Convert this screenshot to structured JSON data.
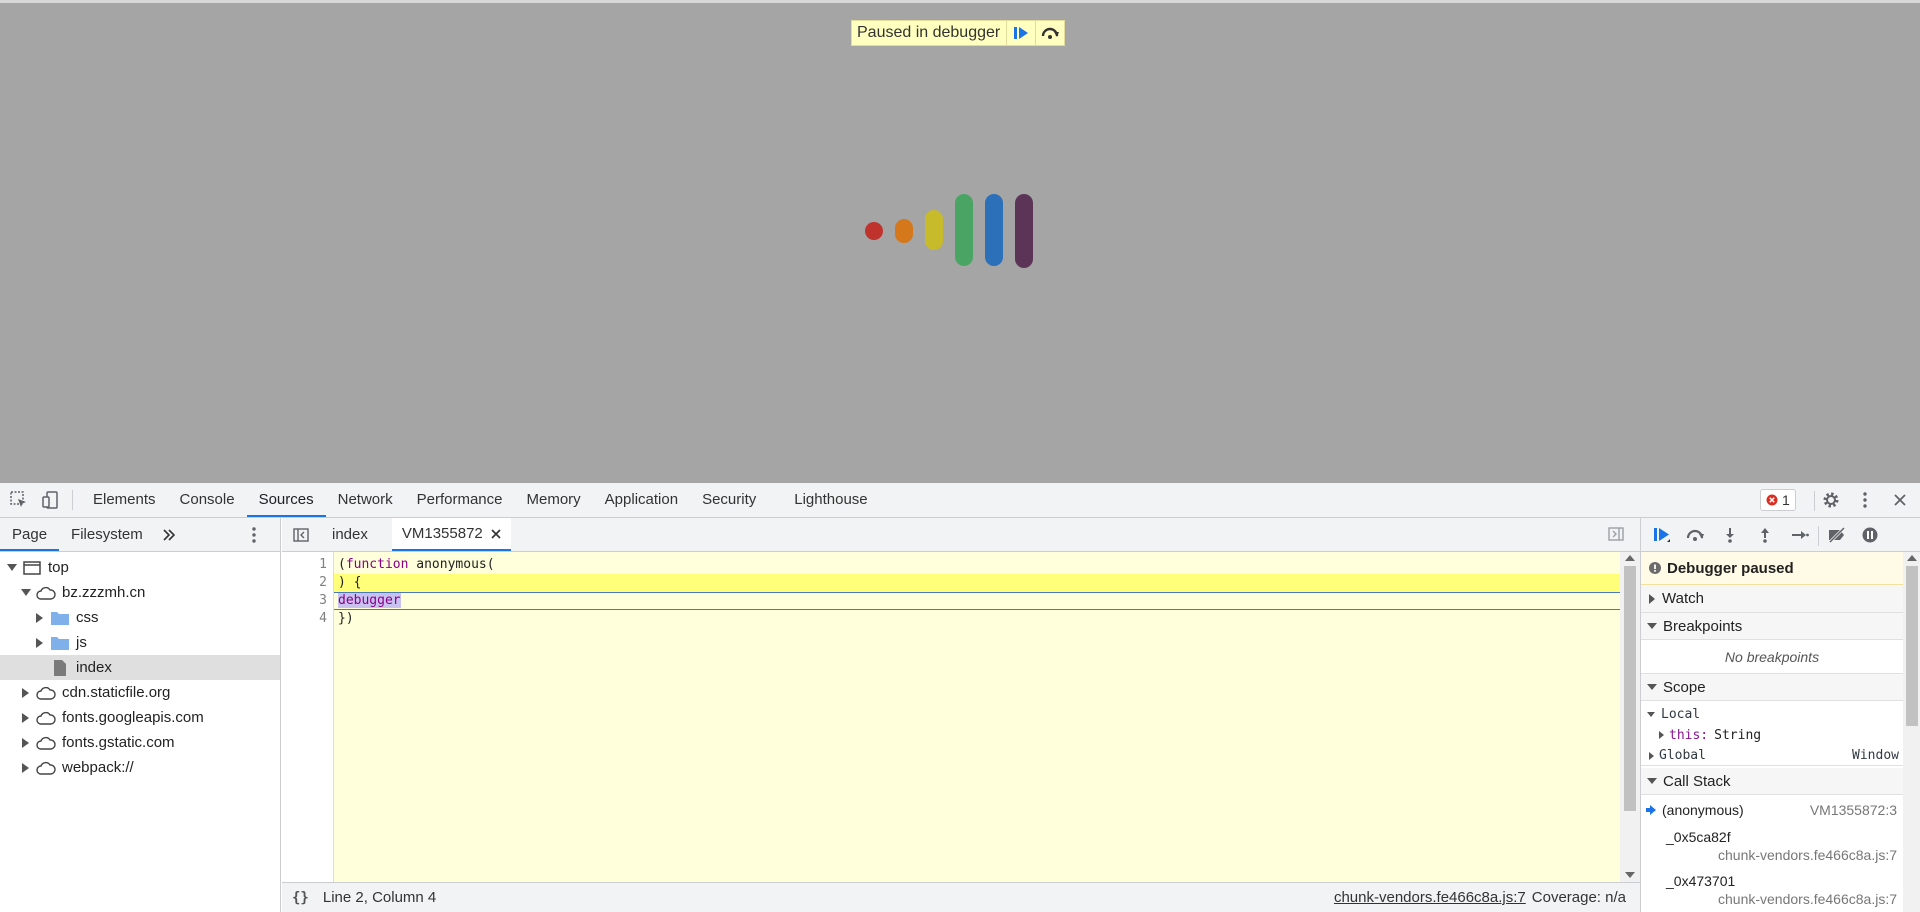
{
  "page": {
    "paused_banner": "Paused in debugger",
    "loader_colors": [
      "#c0322c",
      "#d5781b",
      "#c7ba2b",
      "#4aa564",
      "#2c70b9",
      "#5b3458"
    ]
  },
  "toolbar": {
    "tabs": [
      "Elements",
      "Console",
      "Sources",
      "Network",
      "Performance",
      "Memory",
      "Application",
      "Security",
      "Lighthouse"
    ],
    "active_tab": "Sources",
    "error_count": "1"
  },
  "navigator": {
    "tabs": [
      "Page",
      "Filesystem"
    ],
    "active_tab": "Page",
    "tree": [
      {
        "label": "top",
        "kind": "frame",
        "expanded": true
      },
      {
        "label": "bz.zzzmh.cn",
        "kind": "cloud",
        "expanded": true
      },
      {
        "label": "css",
        "kind": "folder",
        "expanded": false
      },
      {
        "label": "js",
        "kind": "folder",
        "expanded": false
      },
      {
        "label": "index",
        "kind": "file",
        "selected": true
      },
      {
        "label": "cdn.staticfile.org",
        "kind": "cloud",
        "expanded": false
      },
      {
        "label": "fonts.googleapis.com",
        "kind": "cloud",
        "expanded": false
      },
      {
        "label": "fonts.gstatic.com",
        "kind": "cloud",
        "expanded": false
      },
      {
        "label": "webpack://",
        "kind": "cloud",
        "expanded": false
      }
    ]
  },
  "editor": {
    "tabs": [
      "index",
      "VM1355872"
    ],
    "active_tab": "VM1355872",
    "lines": [
      {
        "num": "1",
        "text": "(function anonymous("
      },
      {
        "num": "2",
        "text": ") {"
      },
      {
        "num": "3",
        "text": "debugger"
      },
      {
        "num": "4",
        "text": "})"
      }
    ],
    "status_position": "Line 2, Column 4",
    "status_link": "chunk-vendors.fe466c8a.js:7",
    "coverage": "Coverage: n/a"
  },
  "sidebar": {
    "paused_title": "Debugger paused",
    "watch": "Watch",
    "breakpoints": "Breakpoints",
    "no_breakpoints": "No breakpoints",
    "scope": "Scope",
    "local": "Local",
    "this_key": "this:",
    "this_val": "String",
    "global": "Global",
    "global_val": "Window",
    "call_stack": "Call Stack",
    "frames": [
      {
        "name": "(anonymous)",
        "loc": "VM1355872:3"
      },
      {
        "name": "_0x5ca82f",
        "loc": "chunk-vendors.fe466c8a.js:7"
      },
      {
        "name": "_0x473701",
        "loc": "chunk-vendors.fe466c8a.js:7"
      }
    ]
  }
}
